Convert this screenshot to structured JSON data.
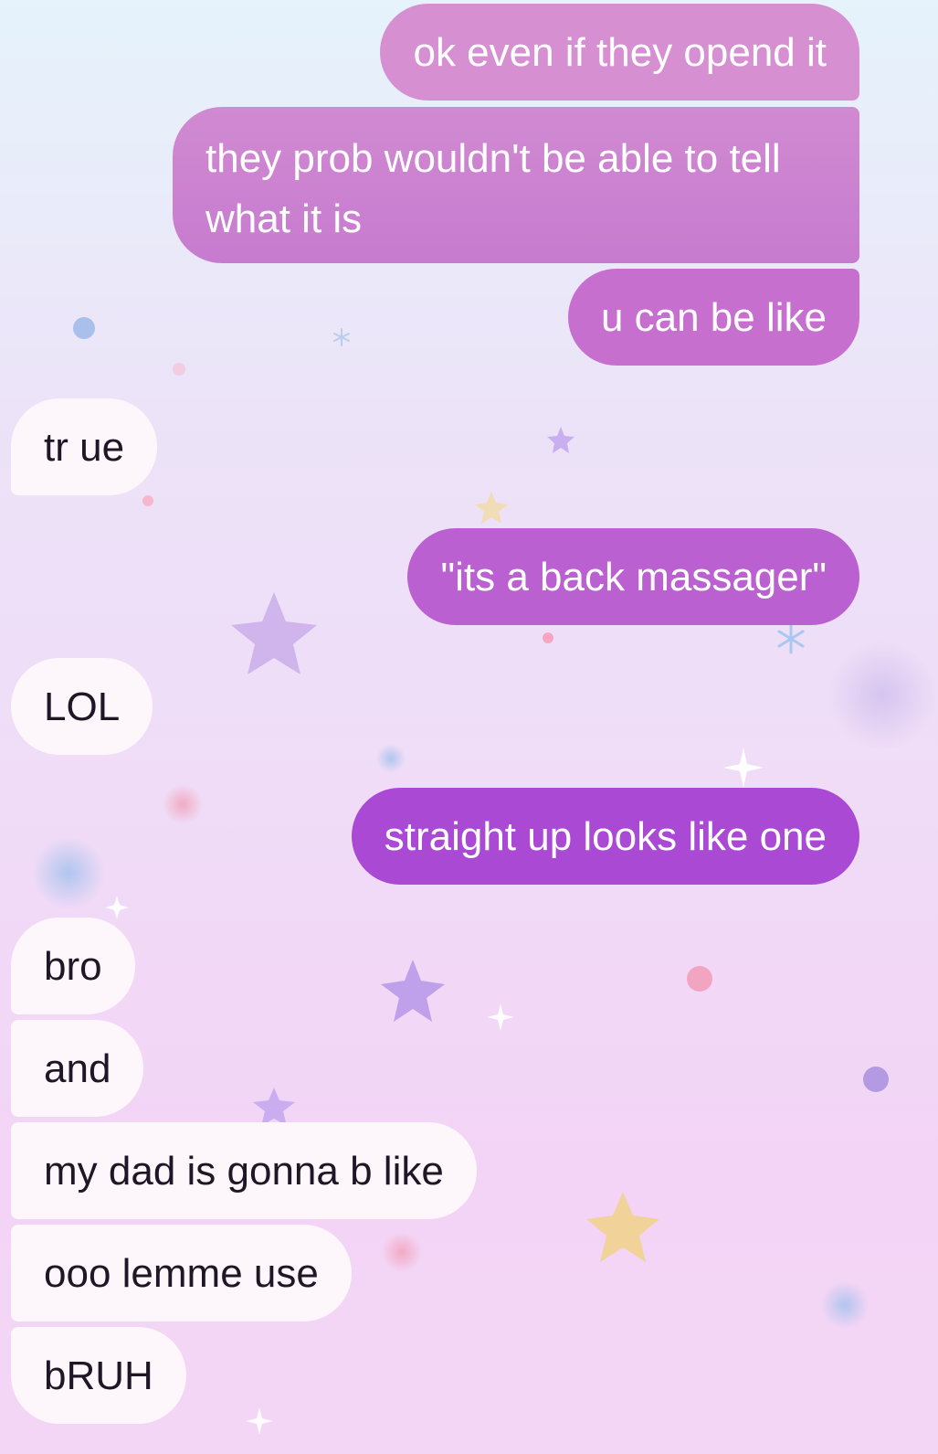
{
  "messages": [
    {
      "side": "out",
      "text": "ok even if they opend it"
    },
    {
      "side": "out",
      "text": "they prob wouldn't be able to tell what it is"
    },
    {
      "side": "out",
      "text": "u can be like"
    },
    {
      "side": "in",
      "text": "tr ue"
    },
    {
      "side": "out",
      "text": "\"its a back massager\""
    },
    {
      "side": "in",
      "text": "LOL"
    },
    {
      "side": "out",
      "text": "straight up looks like one"
    },
    {
      "side": "in",
      "text": "bro"
    },
    {
      "side": "in",
      "text": "and"
    },
    {
      "side": "in",
      "text": "my dad is gonna b like"
    },
    {
      "side": "in",
      "text": "ooo lemme use"
    },
    {
      "side": "in",
      "text": "bRUH"
    }
  ],
  "colors": {
    "outgoing_top": "#d68fd2",
    "outgoing_bottom": "#a648d4",
    "incoming": "#fdf7fc",
    "incoming_text": "#1f1726",
    "outgoing_text": "#ffffff"
  },
  "decorations": [
    "star-icon",
    "sparkle-icon",
    "snowflake-icon",
    "bubble-dot-icon"
  ]
}
